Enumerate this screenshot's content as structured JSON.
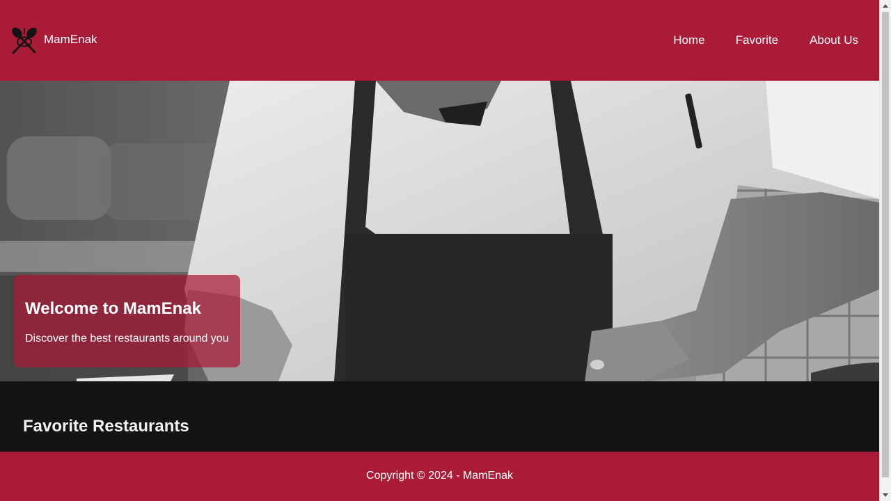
{
  "header": {
    "brand_name": "MamEnak",
    "logo_icon": "crossed-spoon-fork-icon",
    "nav": {
      "home": "Home",
      "favorite": "Favorite",
      "about": "About Us"
    }
  },
  "hero": {
    "image": "grayscale photo of a chef in apron",
    "title": "Welcome to MamEnak",
    "subtitle": "Discover the best restaurants around you"
  },
  "main": {
    "section_title": "Favorite Restaurants"
  },
  "footer": {
    "copyright": "Copyright © 2024 - MamEnak"
  },
  "colors": {
    "brand": "#a91b36",
    "dark_bg": "#141414",
    "text_light": "#ffffff"
  }
}
